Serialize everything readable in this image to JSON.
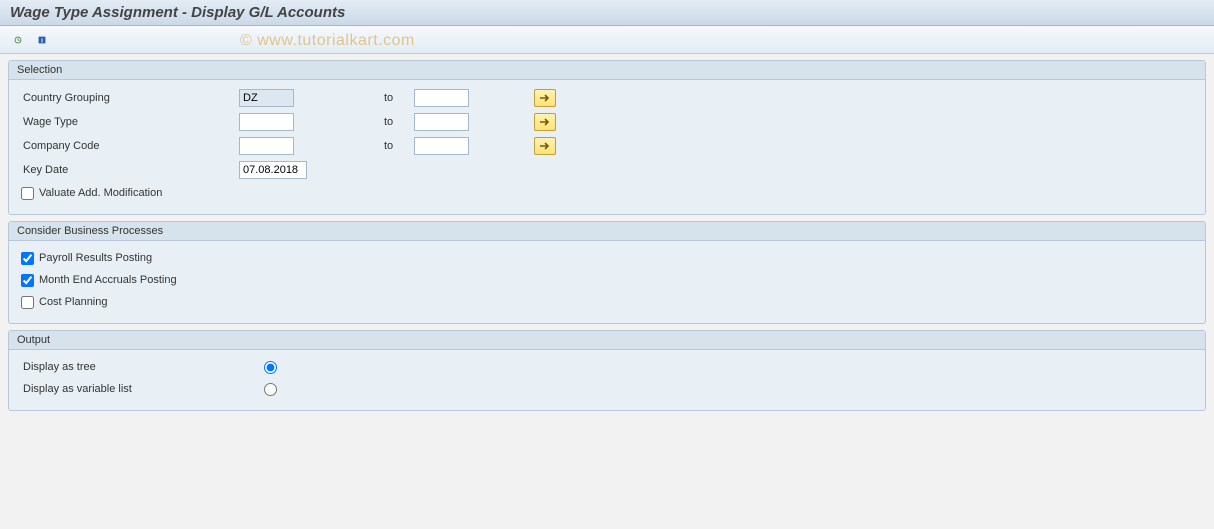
{
  "title": "Wage Type Assignment - Display G/L Accounts",
  "watermark": "© www.tutorialkart.com",
  "selection": {
    "title": "Selection",
    "country_grouping_label": "Country Grouping",
    "country_grouping_from": "DZ",
    "country_grouping_to": "",
    "wage_type_label": "Wage Type",
    "wage_type_from": "",
    "wage_type_to": "",
    "company_code_label": "Company Code",
    "company_code_from": "",
    "company_code_to": "",
    "to_label": "to",
    "key_date_label": "Key Date",
    "key_date_value": "07.08.2018",
    "valuate_label": "Valuate Add. Modification",
    "valuate_checked": false
  },
  "processes": {
    "title": "Consider Business Processes",
    "payroll_label": "Payroll Results Posting",
    "payroll_checked": true,
    "month_end_label": "Month End Accruals Posting",
    "month_end_checked": true,
    "cost_label": "Cost Planning",
    "cost_checked": false
  },
  "output": {
    "title": "Output",
    "tree_label": "Display as tree",
    "list_label": "Display as variable list",
    "selected": "tree"
  }
}
